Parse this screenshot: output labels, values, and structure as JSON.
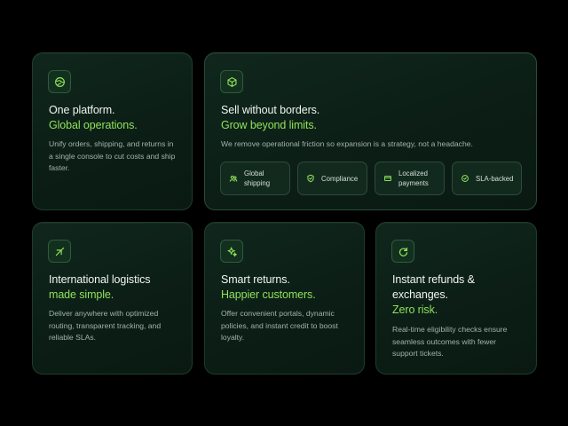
{
  "colors": {
    "background": "#000000",
    "card": "#0d2218",
    "accent": "#8fe25a",
    "text": "#f1f5f2",
    "muted": "#a3b3aa"
  },
  "cards": [
    {
      "icon": "globe-icon",
      "title_line1": "One platform.",
      "title_line2": "Global operations.",
      "description": "Unify orders, shipping, and returns in a single console to cut costs and ship faster."
    },
    {
      "icon": "box-icon",
      "title_line1": "Sell without borders.",
      "title_line2": "Grow beyond limits.",
      "description": "We remove operational friction so expansion is a strategy, not a headache.",
      "pills": [
        {
          "icon": "people-icon",
          "label": "Global shipping"
        },
        {
          "icon": "shield-icon",
          "label": "Compliance"
        },
        {
          "icon": "card-icon",
          "label": "Localized payments"
        },
        {
          "icon": "clock-check-icon",
          "label": "SLA-backed"
        }
      ]
    },
    {
      "icon": "plane-icon",
      "title_line1": "International logistics",
      "title_line2": "made simple.",
      "description": "Deliver anywhere with optimized routing, transparent tracking, and reliable SLAs."
    },
    {
      "icon": "sparkle-icon",
      "title_line1": "Smart returns.",
      "title_line2": "Happier customers.",
      "description": "Offer convenient portals, dynamic policies, and instant credit to boost loyalty."
    },
    {
      "icon": "refresh-icon",
      "title_line1": "Instant refunds &",
      "title_line2": "exchanges.",
      "title_line3": "Zero risk.",
      "description": "Real-time eligibility checks ensure seamless outcomes with fewer support tickets."
    }
  ]
}
